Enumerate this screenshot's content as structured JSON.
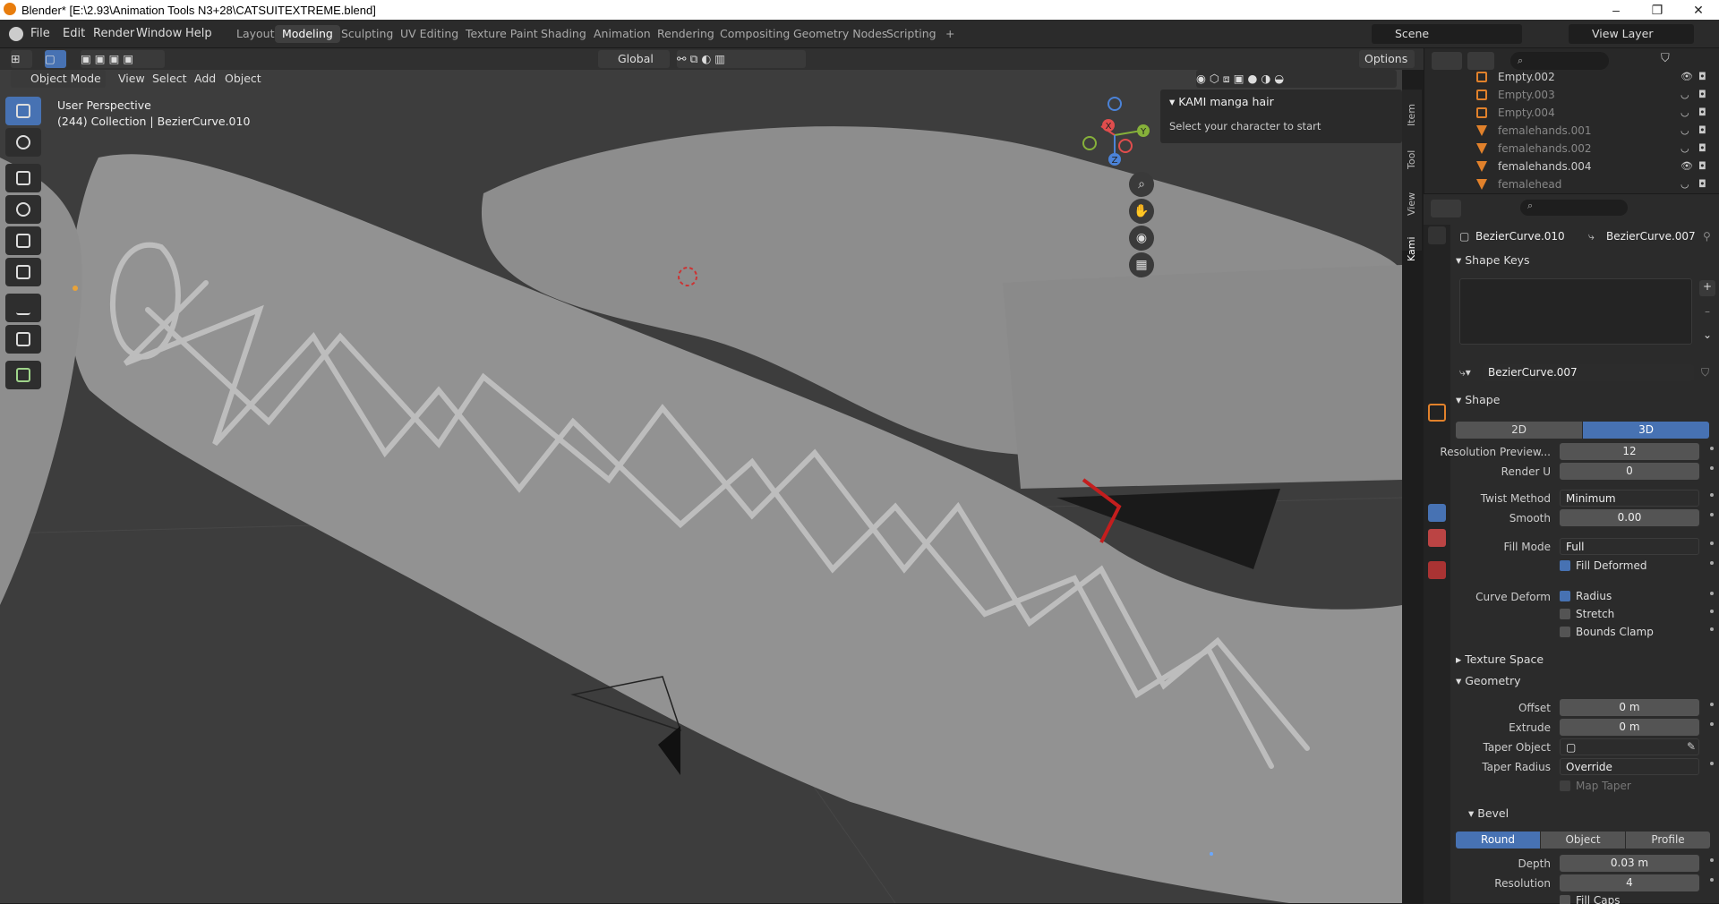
{
  "window": {
    "title": "Blender* [E:\\2.93\\Animation Tools N3+28\\CATSUITEXTREME.blend]"
  },
  "menu": [
    "File",
    "Edit",
    "Render",
    "Window",
    "Help"
  ],
  "workspaces": [
    "Layout",
    "Modeling",
    "Sculpting",
    "UV Editing",
    "Texture Paint",
    "Shading",
    "Animation",
    "Rendering",
    "Compositing",
    "Geometry Nodes",
    "Scripting"
  ],
  "active_workspace": "Modeling",
  "scene": {
    "name": "Scene",
    "view_layer": "View Layer"
  },
  "viewport_header": {
    "transform_orientation": "Global",
    "options": "Options",
    "mode": "Object Mode",
    "menus": [
      "View",
      "Select",
      "Add",
      "Object"
    ]
  },
  "overlay": {
    "perspective": "User Perspective",
    "collection": "(244) Collection | BezierCurve.010"
  },
  "npanel": {
    "title": "KAMI manga hair",
    "text": "Select your character to start",
    "tabs": [
      "Item",
      "Tool",
      "View",
      "Kami"
    ]
  },
  "gizmo": {
    "x": "X",
    "y": "Y",
    "z": "Z"
  },
  "outliner": [
    {
      "name": "Empty.002",
      "type": "empty",
      "visible": true
    },
    {
      "name": "Empty.003",
      "type": "empty",
      "visible": false
    },
    {
      "name": "Empty.004",
      "type": "empty",
      "visible": false
    },
    {
      "name": "femalehands.001",
      "type": "mesh",
      "visible": false
    },
    {
      "name": "femalehands.002",
      "type": "mesh",
      "visible": false
    },
    {
      "name": "femalehands.004",
      "type": "mesh",
      "visible": true
    },
    {
      "name": "femalehead",
      "type": "mesh",
      "visible": false
    }
  ],
  "properties": {
    "object": "BezierCurve.010",
    "data": "BezierCurve.007",
    "data_field": "BezierCurve.007",
    "sections": {
      "shape_keys": "Shape Keys",
      "shape": "Shape",
      "texture_space": "Texture Space",
      "geometry": "Geometry",
      "bevel": "Bevel"
    },
    "shape": {
      "dim_2d": "2D",
      "dim_3d": "3D",
      "resolution_preview_label": "Resolution Preview...",
      "resolution_preview": "12",
      "render_u_label": "Render U",
      "render_u": "0",
      "twist_method_label": "Twist Method",
      "twist_method": "Minimum",
      "smooth_label": "Smooth",
      "smooth": "0.00",
      "fill_mode_label": "Fill Mode",
      "fill_mode": "Full",
      "fill_deformed": "Fill Deformed",
      "curve_deform_label": "Curve Deform",
      "radius": "Radius",
      "stretch": "Stretch",
      "bounds_clamp": "Bounds Clamp"
    },
    "geometry": {
      "offset_label": "Offset",
      "offset": "0 m",
      "extrude_label": "Extrude",
      "extrude": "0 m",
      "taper_object_label": "Taper Object",
      "taper_radius_label": "Taper Radius",
      "taper_radius": "Override",
      "map_taper": "Map Taper"
    },
    "bevel": {
      "modes": [
        "Round",
        "Object",
        "Profile"
      ],
      "depth_label": "Depth",
      "depth": "0.03 m",
      "resolution_label": "Resolution",
      "resolution": "4",
      "fill_caps": "Fill Caps"
    }
  },
  "colors": {
    "accent": "#4772b3",
    "background": "#3d3d3d",
    "panel": "#2b2b2b"
  }
}
